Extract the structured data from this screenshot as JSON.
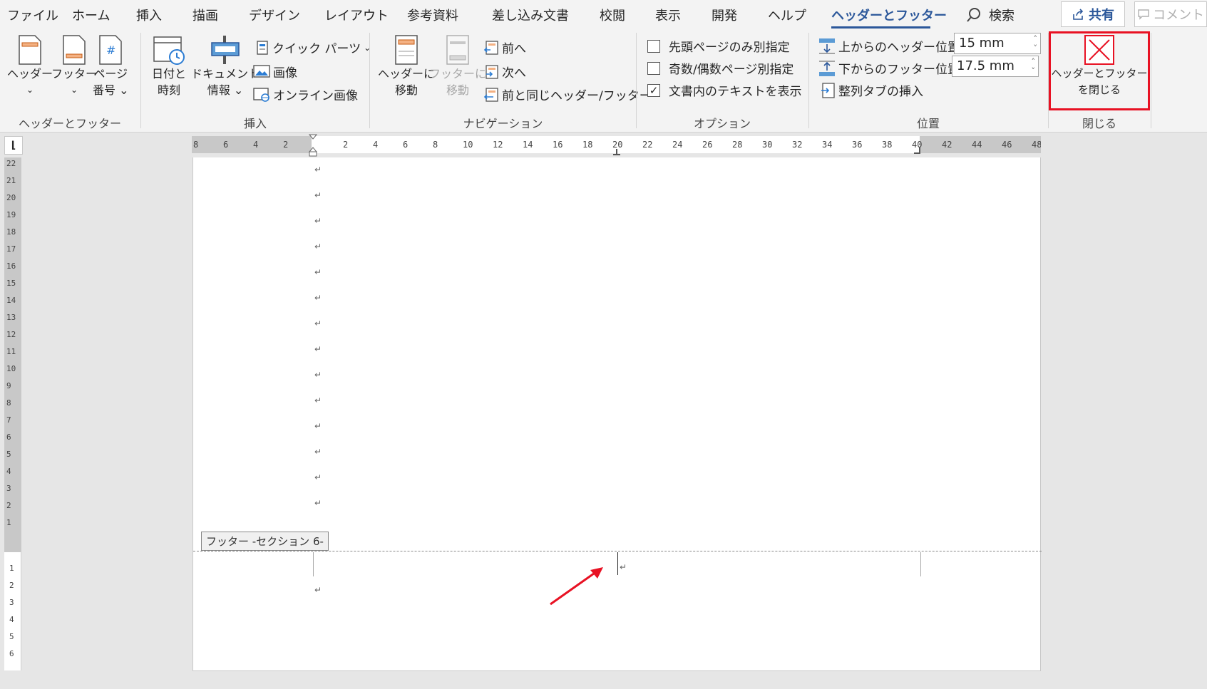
{
  "menu": {
    "tabs": [
      "ファイル",
      "ホーム",
      "挿入",
      "描画",
      "デザイン",
      "レイアウト",
      "参考資料",
      "差し込み文書",
      "校閲",
      "表示",
      "開発",
      "ヘルプ",
      "ヘッダーとフッター"
    ],
    "active_tab": "ヘッダーとフッター",
    "search_label": "検索",
    "share_label": "共有",
    "comment_label": "コメント"
  },
  "ribbon": {
    "hf_group": {
      "label": "ヘッダーとフッター",
      "header_btn": "ヘッダー",
      "footer_btn": "フッター",
      "page_num_line1": "ページ",
      "page_num_line2": "番号"
    },
    "insert_group": {
      "label": "挿入",
      "datetime_line1": "日付と",
      "datetime_line2": "時刻",
      "docinfo_line1": "ドキュメント",
      "docinfo_line2": "情報",
      "quick_parts": "クイック パーツ",
      "image": "画像",
      "online_image": "オンライン画像"
    },
    "nav_group": {
      "label": "ナビゲーション",
      "goto_header_line1": "ヘッダーに",
      "goto_header_line2": "移動",
      "goto_footer_line1": "フッターに",
      "goto_footer_line2": "移動",
      "prev": "前へ",
      "next": "次へ",
      "link_prev": "前と同じヘッダー/フッター"
    },
    "options_group": {
      "label": "オプション",
      "first_page": "先頭ページのみ別指定",
      "odd_even": "奇数/偶数ページ別指定",
      "show_text": "文書内のテキストを表示"
    },
    "position_group": {
      "label": "位置",
      "header_pos_label": "上からのヘッダー位置:",
      "header_pos_value": "15 mm",
      "footer_pos_label": "下からのフッター位置:",
      "footer_pos_value": "17.5 mm",
      "align_tab": "整列タブの挿入"
    },
    "close_group": {
      "label": "閉じる",
      "close_line1": "ヘッダーとフッター",
      "close_line2": "を閉じる"
    }
  },
  "ruler": {
    "ticks": [
      "8",
      "6",
      "4",
      "2",
      "",
      "2",
      "4",
      "6",
      "8",
      "10",
      "12",
      "14",
      "16",
      "18",
      "20",
      "22",
      "24",
      "26",
      "28",
      "30",
      "32",
      "34",
      "36",
      "38",
      "40",
      "42",
      "44",
      "46",
      "48"
    ],
    "vticks_upper": [
      "22",
      "21",
      "20",
      "19",
      "18",
      "17",
      "16",
      "15",
      "14",
      "13",
      "12",
      "11",
      "10",
      "9",
      "8",
      "7",
      "6",
      "5",
      "4",
      "3",
      "2",
      "1"
    ],
    "vticks_lower": [
      "1",
      "2",
      "3",
      "4",
      "5",
      "6"
    ]
  },
  "document": {
    "para_mark": "↵",
    "footer_tag": "フッター -セクション 6-"
  },
  "colors": {
    "accent": "#2b579a",
    "highlight_box": "#e81123",
    "arrow": "#e81123"
  }
}
